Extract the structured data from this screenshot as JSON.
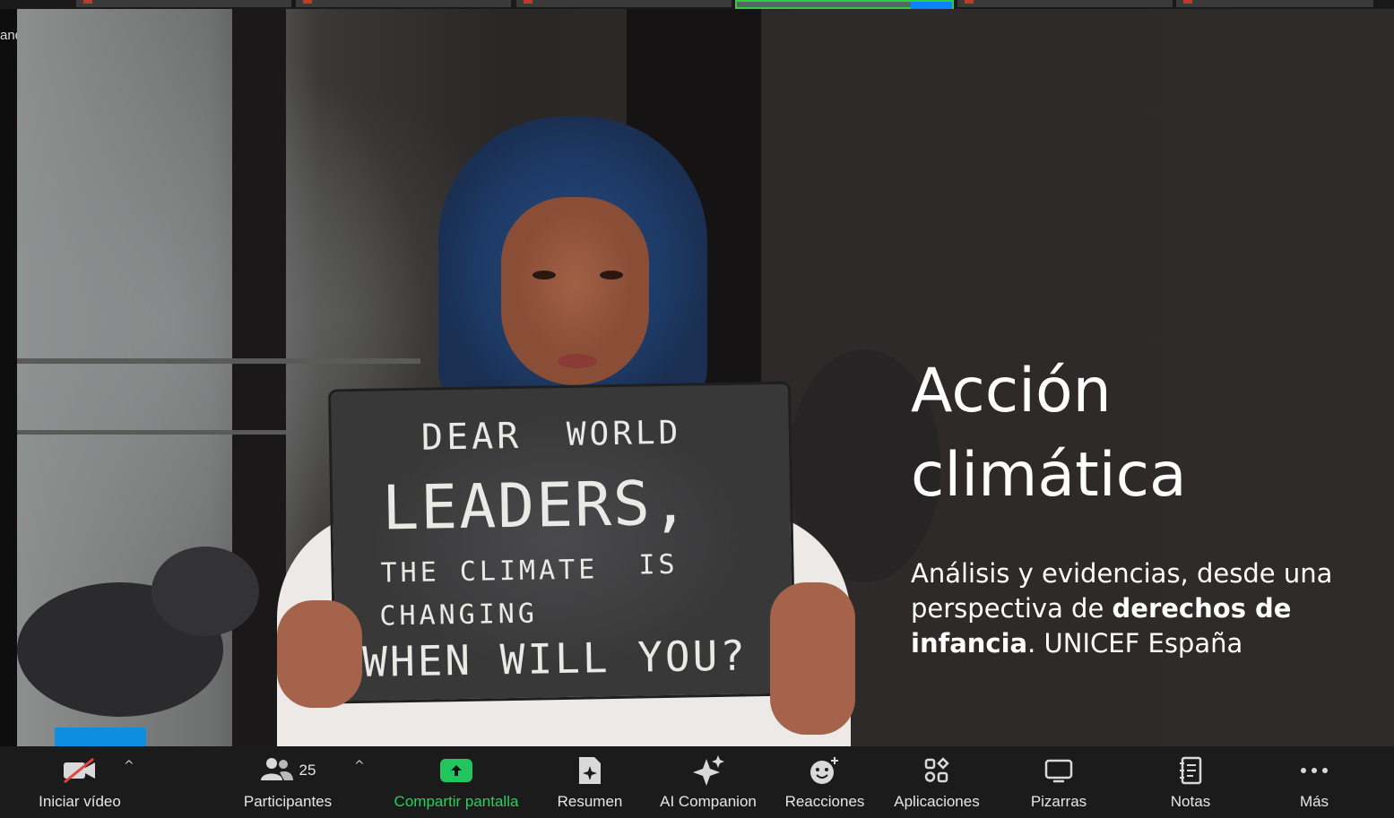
{
  "window": {
    "side_label": "ando"
  },
  "slide": {
    "title_line1": "Acción",
    "title_line2": "climática",
    "subtitle_part1": "Análisis y evidencias, desde una perspectiva de ",
    "subtitle_bold": "derechos de infancia",
    "subtitle_part2": ". UNICEF España",
    "sign_line1a": "DEAR",
    "sign_line1b": "WORLD",
    "sign_line2": "LEADERS,",
    "sign_line3a": "THE CLIMATE",
    "sign_line3b": "IS",
    "sign_line4": "CHANGING",
    "sign_line5": "WHEN WILL YOU?"
  },
  "toolbar": {
    "video": {
      "label": "Iniciar vídeo",
      "icon": "video-off-icon"
    },
    "participants": {
      "label": "Participantes",
      "count": "25",
      "icon": "participants-icon"
    },
    "share": {
      "label": "Compartir pantalla",
      "icon": "share-screen-icon",
      "color": "#22c55e"
    },
    "summary": {
      "label": "Resumen",
      "icon": "summary-icon"
    },
    "ai": {
      "label": "AI Companion",
      "icon": "sparkle-icon"
    },
    "reactions": {
      "label": "Reacciones",
      "icon": "emoji-icon"
    },
    "apps": {
      "label": "Aplicaciones",
      "icon": "apps-icon"
    },
    "whiteboards": {
      "label": "Pizarras",
      "icon": "whiteboard-icon"
    },
    "notes": {
      "label": "Notas",
      "icon": "notes-icon"
    },
    "more": {
      "label": "Más",
      "icon": "more-icon"
    },
    "caret": "^"
  }
}
